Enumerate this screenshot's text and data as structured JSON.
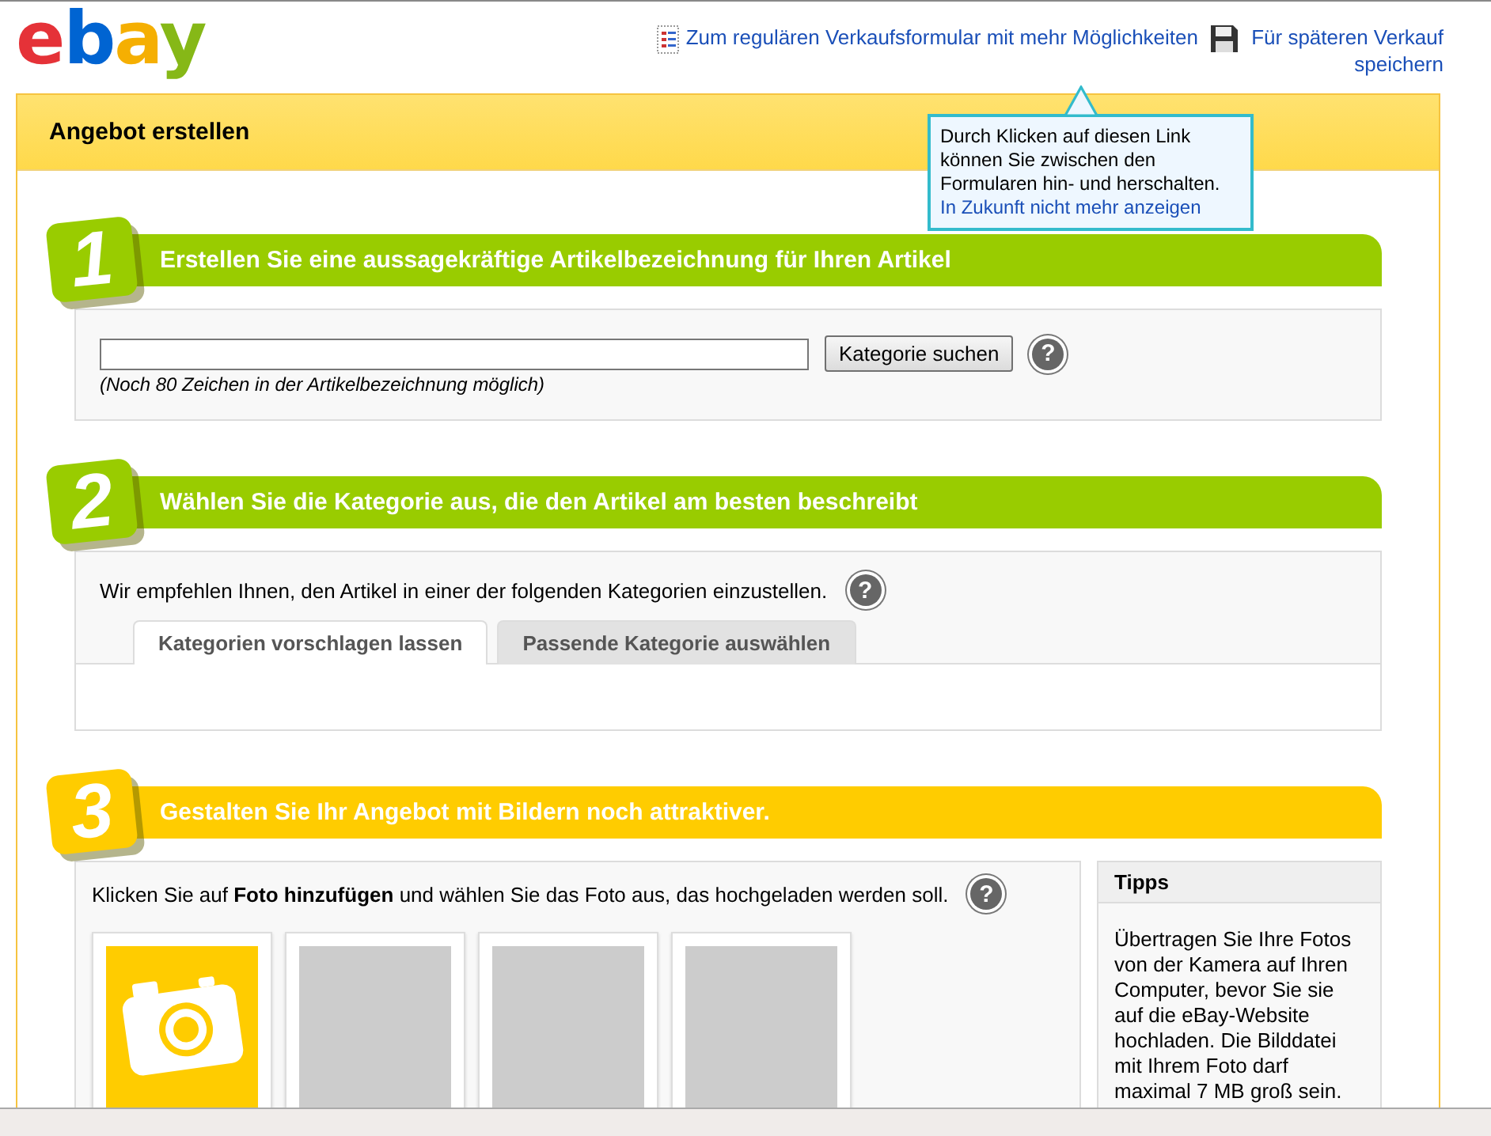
{
  "logo": "ebay",
  "header_links": [
    {
      "kind": "form",
      "label": "Zum regulären Verkaufsformular mit mehr Möglichkeiten"
    },
    {
      "kind": "save",
      "label": "Für späteren Verkauf speichern"
    }
  ],
  "panel": {
    "title": "Angebot erstellen"
  },
  "tooltip": {
    "text": "Durch Klicken auf diesen Link können Sie zwischen den Formularen hin- und herschalten.",
    "link": "In Zukunft nicht mehr anzeigen"
  },
  "steps": [
    {
      "kind": "title",
      "number": "1",
      "color": "#99cc00",
      "title": "Erstellen Sie eine aussagekräftige Artikelbezeichnung für Ihren Artikel",
      "button": "Kategorie suchen",
      "help": "?",
      "hint": "(Noch 80 Zeichen in der Artikelbezeichnung möglich)"
    },
    {
      "kind": "category",
      "number": "2",
      "color": "#99cc00",
      "title": "Wählen Sie die Kategorie aus, die den Artikel am besten beschreibt",
      "text": "Wir empfehlen Ihnen, den Artikel in einer der folgenden Kategorien einzustellen.",
      "help": "?",
      "tabs": [
        {
          "label": "Kategorien vorschlagen lassen",
          "selected": true
        },
        {
          "label": "Passende Kategorie auswählen",
          "selected": false
        }
      ]
    },
    {
      "kind": "photos",
      "number": "3",
      "color": "#ffcc00",
      "title": "Gestalten Sie Ihr Angebot mit Bildern noch attraktiver.",
      "text": "Klicken Sie auf **Foto hinzufügen** und wählen Sie das Foto aus, das hochgeladen werden soll.",
      "help": "?",
      "tiles": [
        {
          "kind": "add"
        },
        {
          "kind": "empty"
        },
        {
          "kind": "empty"
        },
        {
          "kind": "empty"
        }
      ],
      "tips": {
        "title": "Tipps",
        "text": "Übertragen Sie Ihre Fotos von der Kamera auf Ihren Computer, bevor Sie sie auf die eBay-Website hochladen. Die Bilddatei mit Ihrem Foto darf maximal 7 MB groß sein."
      }
    }
  ]
}
